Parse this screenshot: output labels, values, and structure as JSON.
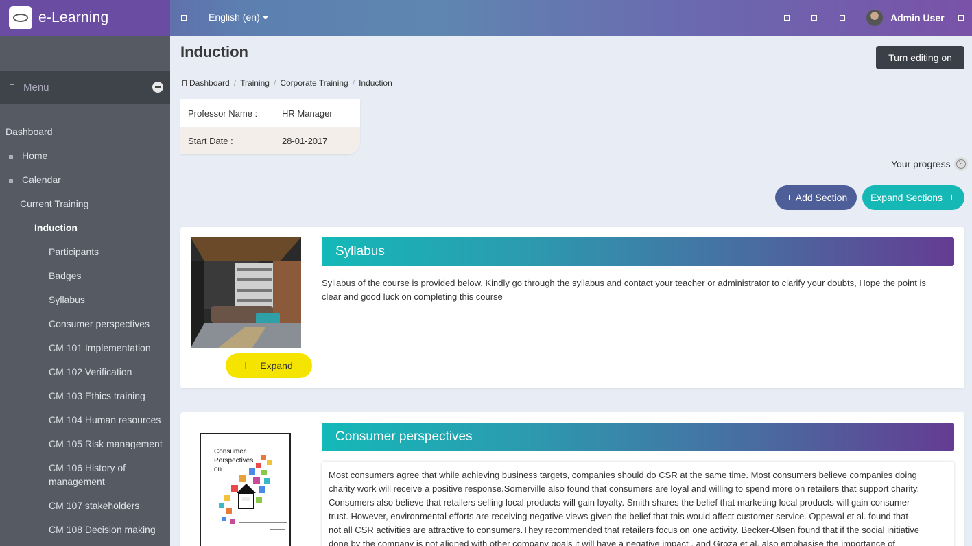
{
  "brand": {
    "name": "e-Learning"
  },
  "topbar": {
    "language": "English (en)",
    "user_name": "Admin User"
  },
  "sidebar": {
    "menu_label": "Menu",
    "items": [
      {
        "label": "Dashboard"
      },
      {
        "label": "Home"
      },
      {
        "label": "Calendar"
      },
      {
        "label": "Current Training"
      },
      {
        "label": "Induction"
      },
      {
        "label": "Participants"
      },
      {
        "label": "Badges"
      },
      {
        "label": "Syllabus"
      },
      {
        "label": "Consumer perspectives"
      },
      {
        "label": "CM 101 Implementation"
      },
      {
        "label": "CM 102 Verification"
      },
      {
        "label": "CM 103 Ethics training"
      },
      {
        "label": "CM 104 Human resources"
      },
      {
        "label": "CM 105 Risk management"
      },
      {
        "label": "CM 106 History of"
      },
      {
        "label": "management"
      },
      {
        "label": "CM 107 stakeholders"
      },
      {
        "label": "CM 108 Decision making"
      }
    ]
  },
  "page": {
    "title": "Induction",
    "edit_button": "Turn editing on",
    "breadcrumb": [
      "Dashboard",
      "Training",
      "Corporate Training",
      "Induction"
    ],
    "info": {
      "professor_label": "Professor Name :",
      "professor_value": "HR Manager",
      "start_label": "Start Date :",
      "start_value": "28-01-2017"
    },
    "progress_label": "Your progress",
    "help_glyph": "?",
    "add_section": "Add Section",
    "expand_sections": "Expand Sections"
  },
  "sections": [
    {
      "title": "Syllabus",
      "text_lines": [
        "Syllabus of the course is provided below. Kindly go through the syllabus and contact your teacher or administrator to clarify your doubts, Hope the point is",
        "clear and good luck on completing this course"
      ],
      "expand_label": "Expand"
    },
    {
      "title": "Consumer perspectives",
      "cover_title": [
        "Consumer",
        "Perspectives",
        "on"
      ],
      "text_lines": [
        "Most consumers agree that while achieving business targets, companies should do CSR at the same time. Most consumers believe companies doing",
        "charity work will receive a positive response.Somerville also found that consumers are loyal and willing to spend more on retailers that support charity.",
        "Consumers also believe that retailers selling local products will gain loyalty. Smith  shares the belief that marketing local products will gain consumer",
        "trust. However, environmental efforts are receiving negative views given the belief that this would affect customer service. Oppewal et al.  found that",
        "not all CSR activities are attractive to consumers.They recommended that retailers focus on one activity. Becker-Olsen  found that if the social initiative",
        "done by the company is not aligned with other company goals it will have a negative impact , and Groza et al. also emphasise the importance of"
      ]
    }
  ],
  "colors": {
    "sidebar_bg": "#555a63",
    "accent_teal": "#16b8b6",
    "accent_purple": "#653c93",
    "expand_yellow": "#f5e400",
    "add_section_blue": "#4d5e98"
  }
}
